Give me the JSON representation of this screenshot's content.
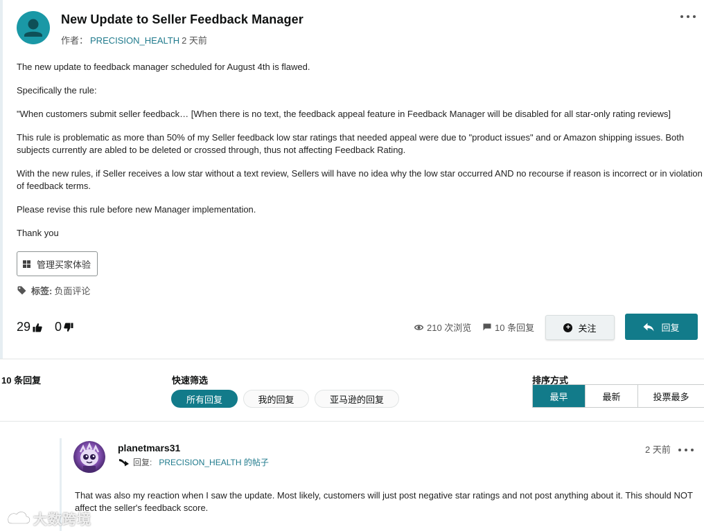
{
  "post": {
    "title": "New Update to Seller Feedback Manager",
    "author_prefix": "作者：",
    "author": "PRECISION_HEALTH",
    "time": "2 天前",
    "body": [
      "The new update to feedback manager scheduled for August 4th is flawed.",
      "Specifically the rule:",
      "\"When customers submit seller feedback… [When there is no text, the feedback appeal feature in Feedback Manager will be disabled for all star-only rating reviews]",
      "This rule is problematic as more than 50% of my Seller feedback low star ratings that needed appeal were due to \"product issues\" and or Amazon shipping issues. Both subjects currently are abled to be deleted or crossed through, thus not affecting Feedback Rating.",
      "With the new rules, if Seller receives a low star without a text review, Sellers will have no idea why the low star occurred AND no recourse if reason is incorrect or in violation of feedback terms.",
      "Please revise this rule before new Manager implementation.",
      "Thank you"
    ],
    "category": "管理买家体验",
    "tags_label": "标签:",
    "tags": "负面评论",
    "upvotes": "29",
    "downvotes": "0",
    "views": "210 次浏览",
    "replies": "10 条回复",
    "follow_label": "关注",
    "reply_label": "回复"
  },
  "replies_section": {
    "count_title": "10 条回复",
    "filter_label": "快速筛选",
    "filters": [
      "所有回复",
      "我的回复",
      "亚马逊的回复"
    ],
    "sort_label": "排序方式",
    "sort_options": [
      "最早",
      "最新",
      "投票最多"
    ]
  },
  "reply1": {
    "username": "planetmars31",
    "reply_prefix": "回复:",
    "reply_target": "PRECISION_HEALTH 的帖子",
    "time": "2 天前",
    "body": "That was also my reaction when I saw the update. Most likely, customers will just post negative star ratings and not post anything about it. This should NOT affect the seller's feedback score."
  },
  "watermark": "大数跨境",
  "colors": {
    "accent": "#127b8a",
    "link": "#1f7a8c",
    "avatar_bg": "#1a98a6"
  }
}
